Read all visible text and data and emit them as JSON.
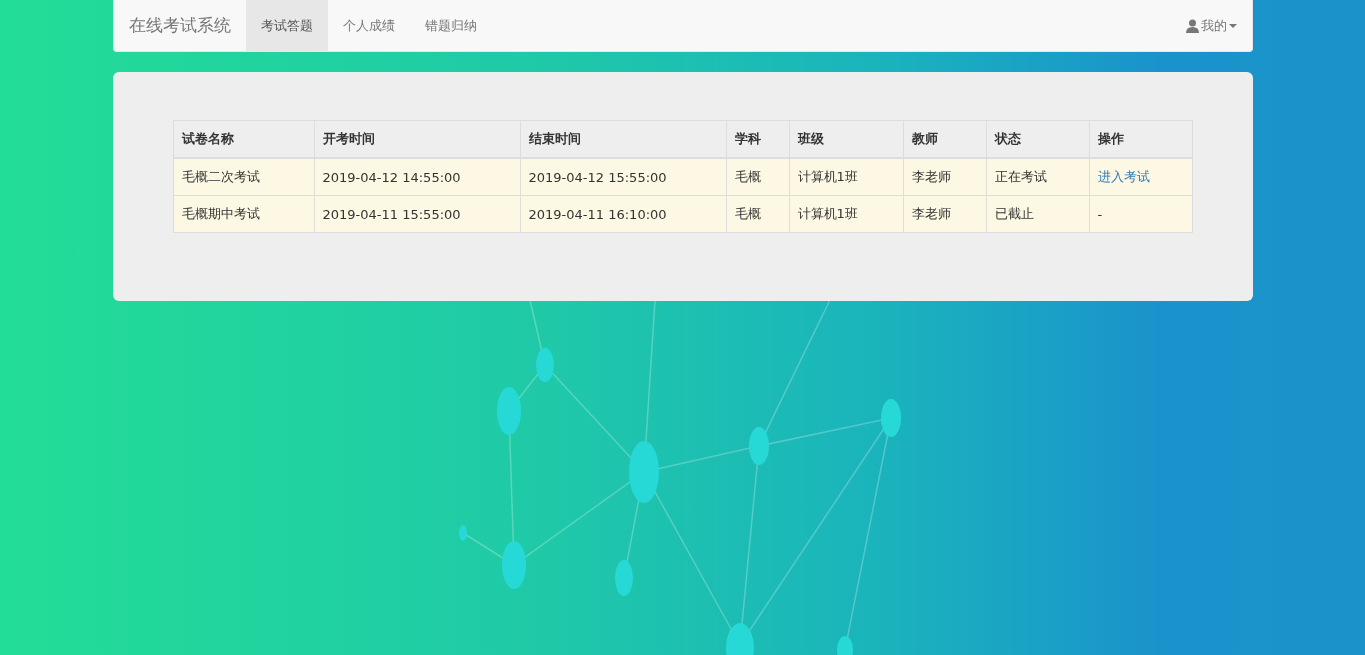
{
  "navbar": {
    "brand": "在线考试系统",
    "tabs": [
      {
        "label": "考试答题",
        "selected": true
      },
      {
        "label": "个人成绩",
        "selected": false
      },
      {
        "label": "错题归纳",
        "selected": false
      }
    ],
    "user_menu": {
      "label": "我的"
    }
  },
  "table": {
    "columns": [
      "试卷名称",
      "开考时间",
      "结束时间",
      "学科",
      "班级",
      "教师",
      "状态",
      "操作"
    ],
    "rows": [
      {
        "cells": [
          "毛概二次考试",
          "2019-04-12 14:55:00",
          "2019-04-12 15:55:00",
          "毛概",
          "计算机1班",
          "李老师",
          "正在考试"
        ],
        "action": {
          "kind": "link",
          "text": "进入考试"
        }
      },
      {
        "cells": [
          "毛概期中考试",
          "2019-04-11 15:55:00",
          "2019-04-11 16:10:00",
          "毛概",
          "计算机1班",
          "李老师",
          "已截止"
        ],
        "action": {
          "kind": "text",
          "text": "-"
        }
      }
    ]
  }
}
